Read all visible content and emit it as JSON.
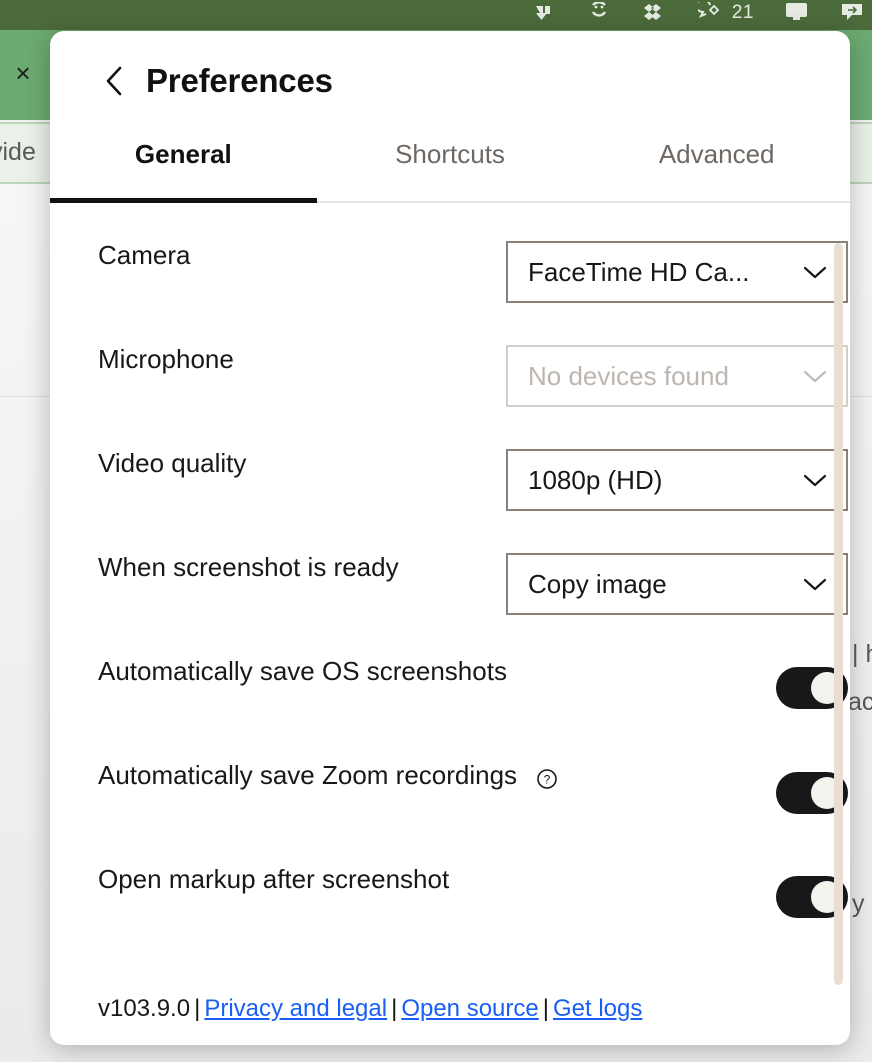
{
  "background": {
    "menubar": {
      "icons": [
        "dropbox-sync-icon",
        "smiley-icon",
        "dropbox-icon",
        "notification-chat-icon",
        "display-icon",
        "share-icon"
      ],
      "badge_count": "21"
    },
    "close_label": "×",
    "band_text": "vide",
    "fragments": [
      "| h",
      "ac",
      "y"
    ]
  },
  "dialog": {
    "back_icon": "chevron-left-icon",
    "title": "Preferences",
    "tabs": [
      {
        "label": "General",
        "active": true
      },
      {
        "label": "Shortcuts",
        "active": false
      },
      {
        "label": "Advanced",
        "active": false
      }
    ],
    "rows": [
      {
        "label": "Camera",
        "control": "select",
        "value": "FaceTime HD Ca...",
        "disabled": false
      },
      {
        "label": "Microphone",
        "control": "select",
        "value": "No devices found",
        "disabled": true
      },
      {
        "label": "Video quality",
        "control": "select",
        "value": "1080p (HD)",
        "disabled": false
      },
      {
        "label": "When screenshot is ready",
        "control": "select",
        "value": "Copy image",
        "disabled": false
      },
      {
        "label": "Automatically save OS screenshots",
        "control": "toggle",
        "value": "on",
        "help": false
      },
      {
        "label": "Automatically save Zoom recordings",
        "control": "toggle",
        "value": "on",
        "help": true,
        "help_icon": "question-circle-icon"
      },
      {
        "label": "Open markup after screenshot",
        "control": "toggle",
        "value": "on",
        "help": false
      }
    ],
    "footer": {
      "version": "v103.9.0",
      "separator": "|",
      "links": [
        {
          "label": "Privacy and legal"
        },
        {
          "label": "Open source"
        },
        {
          "label": "Get logs"
        }
      ]
    }
  },
  "colors": {
    "menubar_green": "#4c6b3b",
    "band_green": "#6cab72",
    "accent_link": "#1a5ff5",
    "toggle_on": "#17181a",
    "scrollbar": "#e8ded2"
  }
}
